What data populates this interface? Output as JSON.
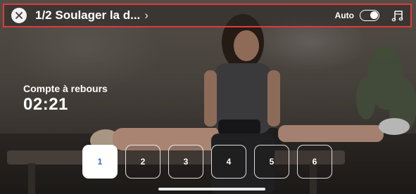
{
  "header": {
    "title": "1/2 Soulager la d...",
    "chevron": "›",
    "auto_label": "Auto",
    "auto_enabled": true,
    "close_icon": "close-icon",
    "music_icon": "music-icon"
  },
  "countdown": {
    "label": "Compte à rebours",
    "value": "02:21"
  },
  "steps": {
    "items": [
      "1",
      "2",
      "3",
      "4",
      "5",
      "6"
    ],
    "active": "1"
  },
  "colors": {
    "highlight_border": "#e03a3a",
    "active_step_text": "#2f6fd6"
  }
}
